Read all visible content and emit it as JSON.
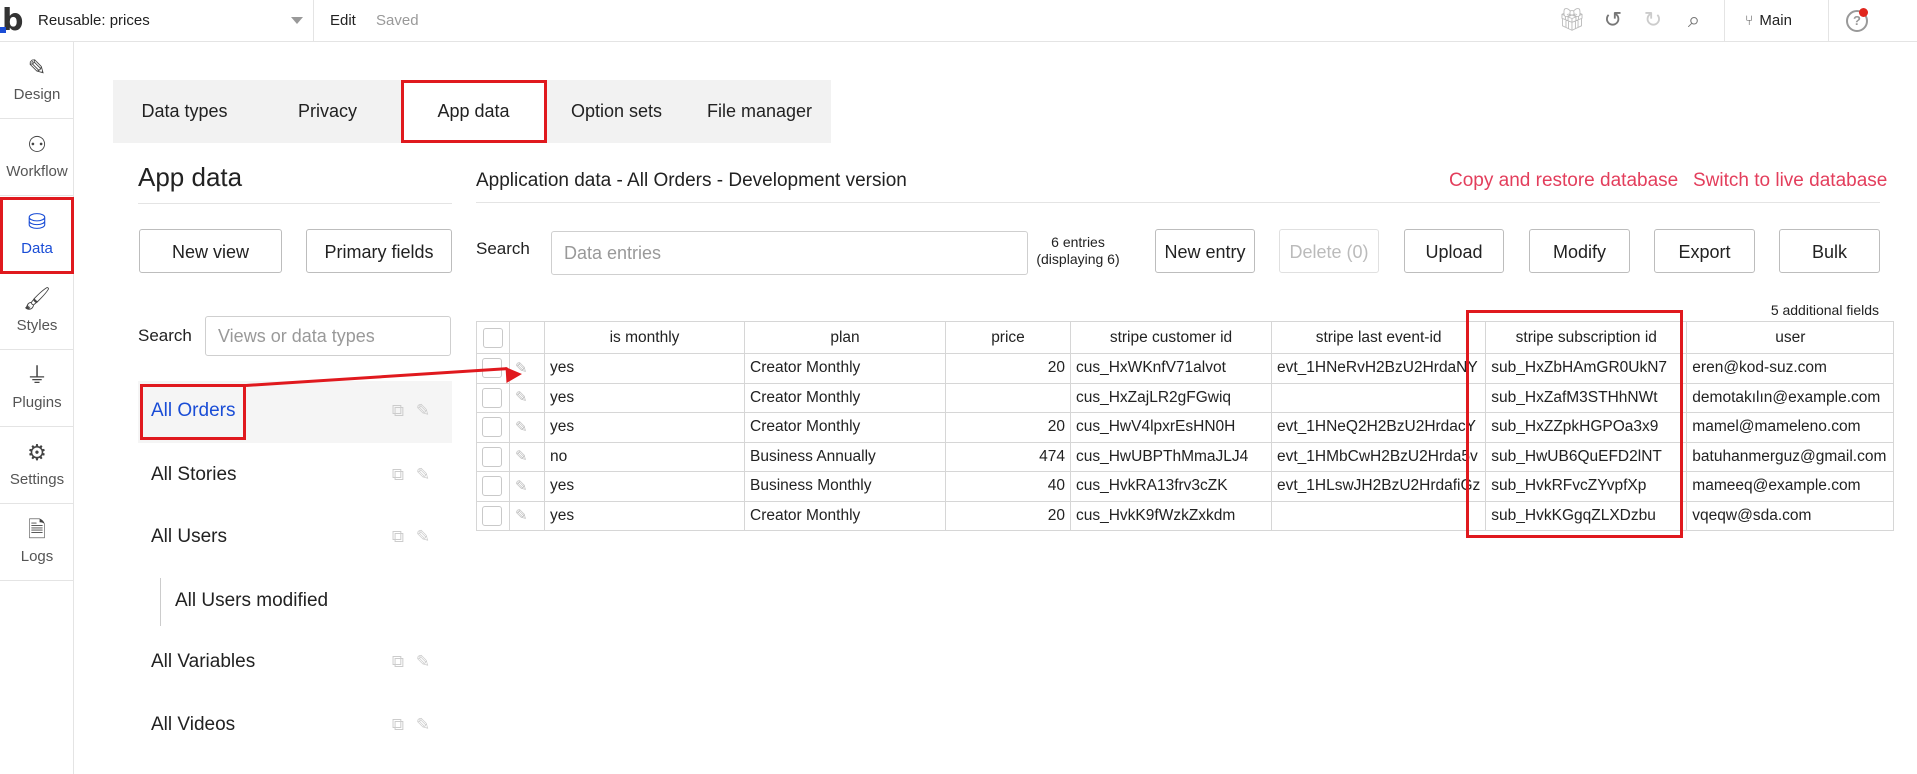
{
  "topbar": {
    "page_name": "Reusable: prices",
    "edit_label": "Edit",
    "saved_label": "Saved",
    "branch_label": "Main",
    "help_label": "?",
    "icons": [
      "gift-icon",
      "undo-icon",
      "redo-icon",
      "search-icon",
      "branch-icon",
      "help-icon"
    ]
  },
  "leftnav": {
    "items": [
      {
        "label": "Design",
        "icon": "design-icon"
      },
      {
        "label": "Workflow",
        "icon": "workflow-icon"
      },
      {
        "label": "Data",
        "icon": "database-icon"
      },
      {
        "label": "Styles",
        "icon": "brush-icon"
      },
      {
        "label": "Plugins",
        "icon": "plug-icon"
      },
      {
        "label": "Settings",
        "icon": "gear-icon"
      },
      {
        "label": "Logs",
        "icon": "document-icon"
      }
    ]
  },
  "tabs": [
    {
      "label": "Data types"
    },
    {
      "label": "Privacy"
    },
    {
      "label": "App data"
    },
    {
      "label": "Option sets"
    },
    {
      "label": "File manager"
    }
  ],
  "sidebar": {
    "title": "App data",
    "new_view_label": "New view",
    "primary_fields_label": "Primary fields",
    "search_label": "Search",
    "search_placeholder": "Views or data types",
    "types": [
      {
        "label": "All Orders"
      },
      {
        "label": "All Stories"
      },
      {
        "label": "All Users"
      },
      {
        "label": "All Users modified"
      },
      {
        "label": "All Variables"
      },
      {
        "label": "All Videos"
      }
    ]
  },
  "main": {
    "heading": "Application data - All Orders - Development version",
    "copy_restore_label": "Copy and restore database",
    "switch_live_label": "Switch to live database",
    "search_label": "Search",
    "search_placeholder": "Data entries",
    "entries_line1": "6 entries",
    "entries_line2": "(displaying 6)",
    "new_entry_label": "New entry",
    "delete_label": "Delete (0)",
    "upload_label": "Upload",
    "modify_label": "Modify",
    "export_label": "Export",
    "bulk_label": "Bulk",
    "additional_fields": "5 additional fields"
  },
  "table": {
    "columns": [
      "is monthly",
      "plan",
      "price",
      "stripe customer id",
      "stripe last event-id",
      "stripe subscription id",
      "user"
    ],
    "rows": [
      [
        "yes",
        "Creator Monthly",
        "20",
        "cus_HxWKnfV71alvot",
        "evt_1HNeRvH2BzU2HrdaNY",
        "sub_HxZbHAmGR0UkN7",
        "eren@kod-suz.com"
      ],
      [
        "yes",
        "Creator Monthly",
        "",
        "cus_HxZajLR2gFGwiq",
        "",
        "sub_HxZafM3STHhNWt",
        "demotakılın@example.com"
      ],
      [
        "yes",
        "Creator Monthly",
        "20",
        "cus_HwV4lpxrEsHN0H",
        "evt_1HNeQ2H2BzU2HrdacY",
        "sub_HxZZpkHGPOa3x9",
        "mamel@mameleno.com"
      ],
      [
        "no",
        "Business Annually",
        "474",
        "cus_HwUBPThMmaJLJ4",
        "evt_1HMbCwH2BzU2Hrda5v",
        "sub_HwUB6QuEFD2lNT",
        "batuhanmerguz@gmail.com"
      ],
      [
        "yes",
        "Business Monthly",
        "40",
        "cus_HvkRA13frv3cZK",
        "evt_1HLswJH2BzU2HrdafiGz",
        "sub_HvkRFvcZYvpfXp",
        "mameeq@example.com"
      ],
      [
        "yes",
        "Creator Monthly",
        "20",
        "cus_HvkK9fWzkZxkdm",
        "",
        "sub_HvkKGgqZLXDzbu",
        "vqeqw@sda.com"
      ]
    ]
  },
  "colors": {
    "accent": "#1a4dd6",
    "link_red": "#e33e5c",
    "annotation_red": "#e0191e"
  }
}
